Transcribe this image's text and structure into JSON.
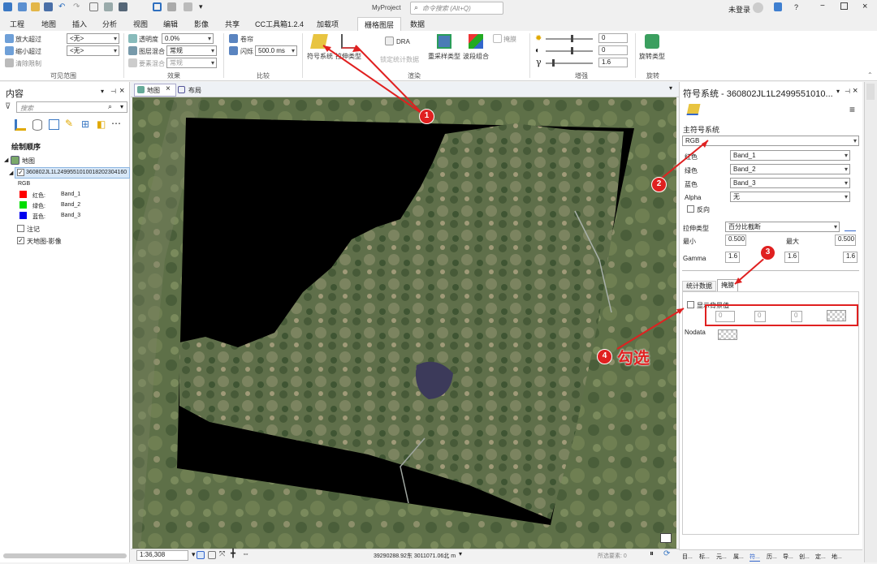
{
  "app": {
    "project_name": "MyProject",
    "search_placeholder": "命令搜索 (Alt+Q)",
    "login_status": "未登录"
  },
  "tabs": [
    "工程",
    "地图",
    "插入",
    "分析",
    "视图",
    "编辑",
    "影像",
    "共享",
    "CC工具箱1.2.4",
    "加载项",
    "栅格图层",
    "数据"
  ],
  "active_tab": "栅格图层",
  "ribbon": {
    "visible_range": {
      "zoom_in_label": "放大超过",
      "zoom_out_label": "缩小超过",
      "clear_label": "清除限制",
      "zoom_in_value": "<无>",
      "zoom_out_value": "<无>",
      "group_label": "可见范围"
    },
    "effects": {
      "transparency_label": "透明度",
      "transparency_value": "0.0%",
      "blend_label": "图层混合",
      "blend_value": "常规",
      "feature_blend_label": "要素混合",
      "feature_blend_value": "常规",
      "group_label": "效果"
    },
    "compare": {
      "swipe_label": "卷帘",
      "flicker_label": "闪烁",
      "flicker_value": "500.0 ms",
      "group_label": "比较"
    },
    "rendering": {
      "symbology_label": "符号系统",
      "stretch_label": "拉伸类型",
      "dra_label": "DRA",
      "lock_stats_label": "锁定统计数据",
      "resample_label": "重采样类型",
      "band_combo_label": "波段组合",
      "mask_label": "掩膜",
      "group_label": "渲染"
    },
    "enhance": {
      "brightness_value": "0",
      "contrast_value": "0",
      "gamma_value": "1.6",
      "gamma_symbol": "γ",
      "group_label": "增强"
    },
    "rotate": {
      "rotate_label": "旋转类型",
      "group_label": "旋转"
    }
  },
  "contents": {
    "title": "内容",
    "search_placeholder": "搜索",
    "draw_order_label": "绘制顺序",
    "map_label": "地图",
    "layer_name": "360802JL1L2499551010018202304160",
    "rgb_label": "RGB",
    "bands": [
      {
        "label": "红色:",
        "band": "Band_1",
        "color": "#ff0000"
      },
      {
        "label": "绿色:",
        "band": "Band_2",
        "color": "#00dd00"
      },
      {
        "label": "蓝色:",
        "band": "Band_3",
        "color": "#0000ee"
      }
    ],
    "notes_label": "注记",
    "basemap_label": "天地图-影像"
  },
  "map_view": {
    "tabs": [
      "地图",
      "布局"
    ],
    "scale": "1:36,308",
    "coords": "39290288.92东 3011071.06北 m",
    "selected": "所选要素: 0"
  },
  "symbology": {
    "title": "符号系统 - 360802JL1L2499551010...",
    "primary_label": "主符号系统",
    "type_value": "RGB",
    "rows": [
      {
        "label": "红色",
        "value": "Band_1"
      },
      {
        "label": "绿色",
        "value": "Band_2"
      },
      {
        "label": "蓝色",
        "value": "Band_3"
      },
      {
        "label": "Alpha",
        "value": "无"
      }
    ],
    "invert_label": "反向",
    "stretch_label": "拉伸类型",
    "stretch_value": "百分比截断",
    "min_label": "最小",
    "min_value": "0.500",
    "max_label": "最大",
    "max_value": "0.500",
    "gamma_label": "Gamma",
    "gamma_values": [
      "1.6",
      "1.6",
      "1.6"
    ],
    "subtabs": [
      "统计数据",
      "掩膜"
    ],
    "background_label": "显示背景值",
    "background_values": [
      "0",
      "0",
      "0"
    ],
    "nodata_label": "Nodata",
    "bottom_tabs": [
      "目...",
      "标...",
      "元...",
      "属...",
      "符...",
      "历...",
      "导...",
      "创...",
      "定...",
      "地..."
    ]
  },
  "annotations": {
    "markers": [
      "1",
      "2",
      "3",
      "4"
    ],
    "check_text": "勾选",
    "color": "#e02020"
  }
}
